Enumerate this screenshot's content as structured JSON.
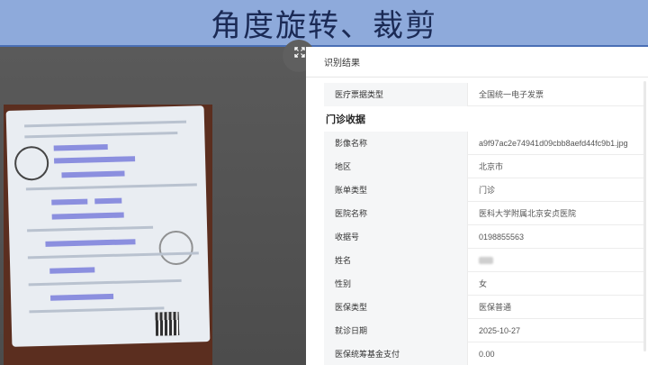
{
  "banner": {
    "title": "角度旋转、裁剪"
  },
  "viewer": {
    "expand_icon": "expand-arrows-icon"
  },
  "panel": {
    "header": "识别结果",
    "top_rows": [
      {
        "label": "医疗票据类型",
        "value": "全国统一电子发票"
      }
    ],
    "section_title": "门诊收据",
    "rows": [
      {
        "label": "影像名称",
        "value": "a9f97ac2e74941d09cbb8aefd44fc9b1.jpg"
      },
      {
        "label": "地区",
        "value": "北京市"
      },
      {
        "label": "账单类型",
        "value": "门诊"
      },
      {
        "label": "医院名称",
        "value": "医科大学附属北京安贞医院"
      },
      {
        "label": "收据号",
        "value": "0198855563"
      },
      {
        "label": "姓名",
        "value": ""
      },
      {
        "label": "性别",
        "value": "女"
      },
      {
        "label": "医保类型",
        "value": "医保普通"
      },
      {
        "label": "就诊日期",
        "value": "2025-10-27"
      },
      {
        "label": "医保统筹基金支付",
        "value": "0.00"
      }
    ]
  }
}
